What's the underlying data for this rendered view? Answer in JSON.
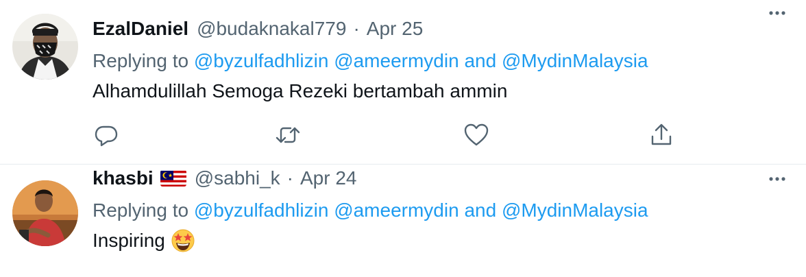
{
  "tweets": [
    {
      "name": "EzalDaniel",
      "handle": "@budaknakal779",
      "separator": "·",
      "date": "Apr 25",
      "replying_prefix": "Replying to",
      "mention_1": "@byzulfadhlizin",
      "mention_2": "@ameermydin",
      "conj": "and",
      "mention_3": "@MydinMalaysia",
      "text": "Alhamdulillah Semoga Rezeki bertambah ammin",
      "has_flag": false
    },
    {
      "name": "khasbi",
      "handle": "@sabhi_k",
      "separator": "·",
      "date": "Apr 24",
      "replying_prefix": "Replying to",
      "mention_1": "@byzulfadhlizin",
      "mention_2": "@ameermydin",
      "conj": "and",
      "mention_3": "@MydinMalaysia",
      "text": "Inspiring",
      "has_flag": true,
      "flag_icon": "malaysia-flag-icon",
      "emoji_icon": "star-struck-emoji-icon"
    }
  ],
  "colors": {
    "text": "#0f1419",
    "secondary": "#536471",
    "link": "#1d9bf0",
    "divider": "#e6ecf0"
  }
}
